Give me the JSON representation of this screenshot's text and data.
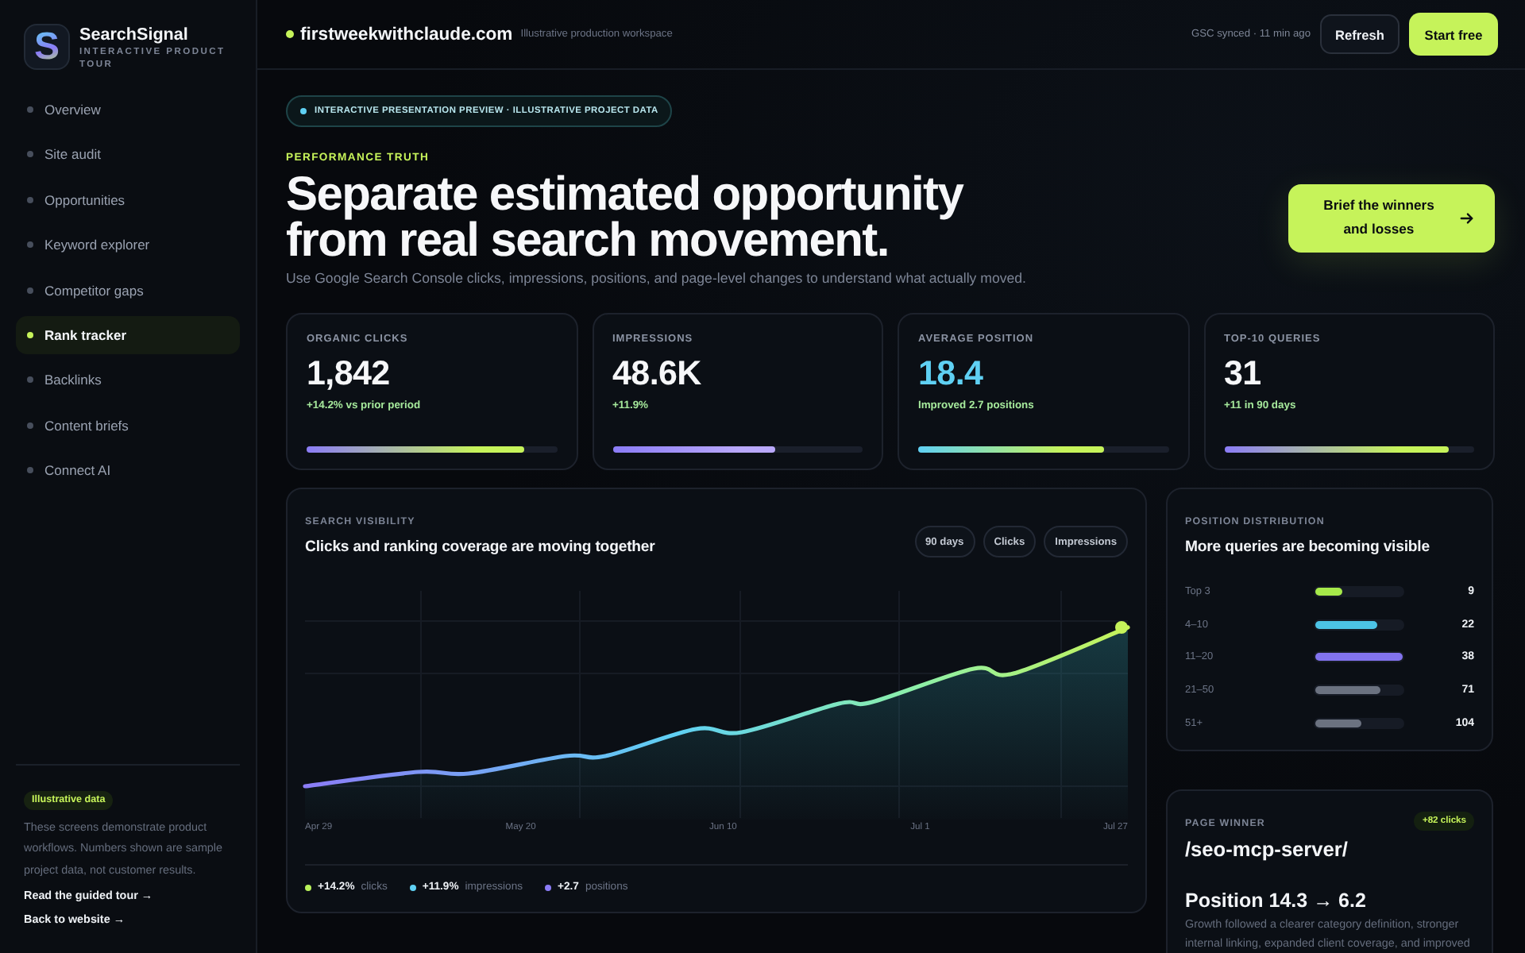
{
  "sidebar": {
    "logo_letter": "S",
    "brand": "SearchSignal",
    "tagline": "INTERACTIVE PRODUCT TOUR",
    "nav": [
      {
        "label": "Overview",
        "selected": false
      },
      {
        "label": "Site audit",
        "selected": false
      },
      {
        "label": "Opportunities",
        "selected": false
      },
      {
        "label": "Keyword explorer",
        "selected": false
      },
      {
        "label": "Competitor gaps",
        "selected": false
      },
      {
        "label": "Rank tracker",
        "selected": true
      },
      {
        "label": "Backlinks",
        "selected": false
      },
      {
        "label": "Content briefs",
        "selected": false
      },
      {
        "label": "Connect AI",
        "selected": false
      }
    ],
    "notice": {
      "badge": "Illustrative data",
      "text": "These screens demonstrate product workflows. Numbers shown are sample project data, not customer results.",
      "links": [
        "Read the guided tour →",
        "Back to website →"
      ]
    }
  },
  "topbar": {
    "site": "firstweekwithclaude.com",
    "workspace": "Illustrative production workspace",
    "sync_status": "GSC synced · 11 min ago",
    "refresh_button": "Refresh",
    "start_button": "Start free"
  },
  "hero": {
    "preview_pill": "INTERACTIVE PRESENTATION PREVIEW · ILLUSTRATIVE PROJECT DATA",
    "eyebrow": "PERFORMANCE TRUTH",
    "title": "Separate estimated opportunity from real search movement.",
    "subtitle": "Use Google Search Console clicks, impressions, positions, and page-level changes to understand what actually moved.",
    "cta": "Brief the winners and losses"
  },
  "metrics": [
    {
      "label": "ORGANIC CLICKS",
      "value": "1,842",
      "delta": "+14.2% vs prior period",
      "level": 0.87,
      "highlight": false,
      "color": "#c6f35a"
    },
    {
      "label": "IMPRESSIONS",
      "value": "48.6K",
      "delta": "+11.9%",
      "level": 0.65,
      "highlight": false,
      "color": "#b9a8fb"
    },
    {
      "label": "AVERAGE POSITION",
      "value": "18.4",
      "delta": "Improved 2.7 positions",
      "level": 0.74,
      "highlight": true,
      "color": "#c6f35a"
    },
    {
      "label": "TOP-10 QUERIES",
      "value": "31",
      "delta": "+11 in 90 days",
      "level": 0.9,
      "highlight": false,
      "color": "#c6f35a"
    }
  ],
  "visibility": {
    "label": "SEARCH VISIBILITY",
    "title": "Clicks and ranking coverage are moving together",
    "filters": [
      "90 days",
      "Clicks",
      "Impressions"
    ],
    "x_labels": [
      "Apr 29",
      "May 20",
      "Jun 10",
      "Jul 1",
      "Jul 27"
    ],
    "legend": [
      {
        "value": "+14.2%",
        "label": "clicks",
        "color": "#b9f25a"
      },
      {
        "value": "+11.9%",
        "label": "impressions",
        "color": "#5fd0f3"
      },
      {
        "value": "+2.7",
        "label": "positions",
        "color": "#8b7cf6"
      }
    ]
  },
  "distribution": {
    "label": "POSITION DISTRIBUTION",
    "title": "More queries are becoming visible",
    "rows": [
      {
        "range": "Top 3",
        "count": "9",
        "level": 0.3,
        "color": "#a6e94a"
      },
      {
        "range": "4–10",
        "count": "22",
        "level": 0.71,
        "color": "#4cc3e6"
      },
      {
        "range": "11–20",
        "count": "38",
        "level": 1,
        "color": "#8273ee"
      },
      {
        "range": "21–50",
        "count": "71",
        "level": 0.75,
        "color": "#6b7280"
      },
      {
        "range": "51+",
        "count": "104",
        "level": 0.53,
        "color": "#6b7280"
      }
    ]
  },
  "page_winner": {
    "label": "PAGE WINNER",
    "badge": "+82 clicks",
    "page": "/seo-mcp-server/",
    "change": "Position 14.3 → 6.2",
    "text": "Growth followed a clearer category definition, stronger internal linking, expanded client coverage, and improved"
  }
}
